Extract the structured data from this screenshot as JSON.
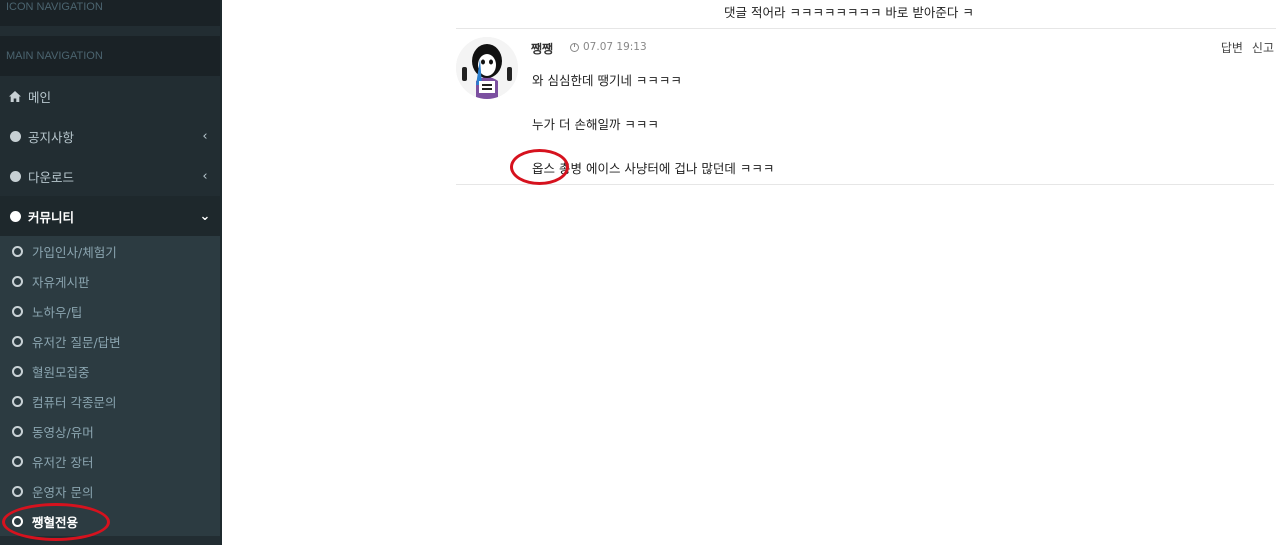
{
  "sidebar": {
    "icon_nav_header": "ICON NAVIGATION",
    "main_nav_header": "MAIN NAVIGATION",
    "items": [
      {
        "label": "메인",
        "icon": "home-icon",
        "has_chevron": false
      },
      {
        "label": "공지사항",
        "icon": "circle-icon",
        "chevron": "‹"
      },
      {
        "label": "다운로드",
        "icon": "circle-icon",
        "chevron": "‹"
      },
      {
        "label": "커뮤니티",
        "icon": "circle-icon",
        "chevron": "⌄",
        "active": true
      }
    ],
    "community_submenu": [
      {
        "label": "가입인사/체험기"
      },
      {
        "label": "자유게시판"
      },
      {
        "label": "노하우/팁"
      },
      {
        "label": "유저간 질문/답변"
      },
      {
        "label": "혈원모집중"
      },
      {
        "label": "컴퓨터 각종문의"
      },
      {
        "label": "동영상/유머"
      },
      {
        "label": "유저간 장터"
      },
      {
        "label": "운영자 문의"
      },
      {
        "label": "쨍혈전용",
        "current": true
      }
    ]
  },
  "content": {
    "top_comment_text": "댓글 적어라 ㅋㅋㅋㅋㅋㅋㅋㅋ 바로 받아준다 ㅋ",
    "comment": {
      "author": "쨍쨍",
      "time": "07.07 19:13",
      "actions": [
        "답변",
        "신고"
      ],
      "lines": [
        "와 심심한데 땡기네 ㅋㅋㅋㅋ",
        "누가 더 손해일까 ㅋㅋㅋ",
        "옵스 총병 에이스 사냥터에 겁나 많던데 ㅋㅋㅋ"
      ]
    }
  },
  "colors": {
    "sidebar_bg": "#222d32",
    "submenu_bg": "#2c3b41",
    "annotation_red": "#d6121e"
  }
}
